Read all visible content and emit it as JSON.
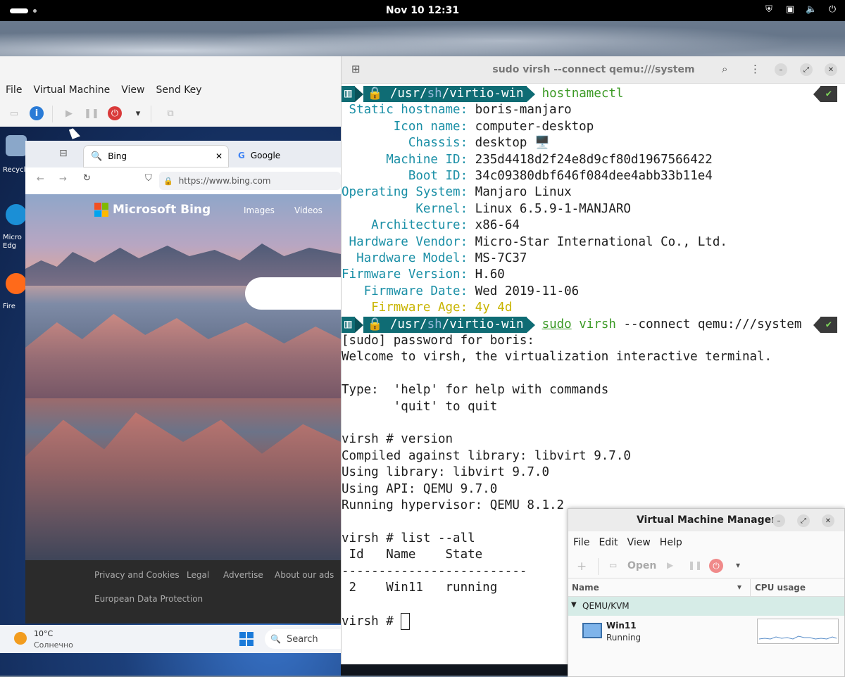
{
  "topbar": {
    "clock": "Nov 10  12:31",
    "icons": [
      "shield-icon",
      "display-icon",
      "volume-icon",
      "power-icon"
    ]
  },
  "vm_viewer": {
    "menu": [
      "File",
      "Virtual Machine",
      "View",
      "Send Key"
    ],
    "guest": {
      "desktop_icons": [
        "Recycl",
        "Micro Edg",
        "Fire"
      ],
      "browser": {
        "tabs": [
          "Bing",
          "Google"
        ],
        "url": "https://www.bing.com",
        "bing_logo": "Microsoft Bing",
        "nav": [
          "Images",
          "Videos"
        ],
        "footer": [
          "Privacy and Cookies",
          "Legal",
          "Advertise",
          "About our ads",
          "European Data Protection"
        ]
      },
      "taskbar": {
        "temp": "10°C",
        "weather": "Солнечно",
        "search": "Search"
      }
    }
  },
  "terminal": {
    "title": "sudo virsh --connect qemu:///system",
    "prompt": {
      "usr": "/usr/",
      "sh": "sh",
      "dir": "/virtio-win"
    },
    "cmd1": "hostnamectl",
    "hostinfo": [
      {
        "k": " Static hostname:",
        "v": "boris-manjaro"
      },
      {
        "k": "       Icon name:",
        "v": "computer-desktop"
      },
      {
        "k": "         Chassis:",
        "v": "desktop 🖥️"
      },
      {
        "k": "      Machine ID:",
        "v": "235d4418d2f24e8d9cf80d1967566422"
      },
      {
        "k": "         Boot ID:",
        "v": "34c09380dbf646f084dee4abb33b11e4"
      },
      {
        "k": "Operating System:",
        "v": "Manjaro Linux"
      },
      {
        "k": "          Kernel:",
        "v": "Linux 6.5.9-1-MANJARO"
      },
      {
        "k": "    Architecture:",
        "v": "x86-64"
      },
      {
        "k": " Hardware Vendor:",
        "v": "Micro-Star International Co., Ltd."
      },
      {
        "k": "  Hardware Model:",
        "v": "MS-7C37"
      },
      {
        "k": "Firmware Version:",
        "v": "H.60"
      },
      {
        "k": "   Firmware Date:",
        "v": "Wed 2019-11-06"
      },
      {
        "k": "    Firmware Age:",
        "v": "4y 4d"
      }
    ],
    "cmd2_sudo": "sudo",
    "cmd2_virsh": "virsh",
    "cmd2_rest": " --connect qemu:///system",
    "output": [
      "[sudo] password for boris:",
      "Welcome to virsh, the virtualization interactive terminal.",
      "",
      "Type:  'help' for help with commands",
      "       'quit' to quit",
      "",
      "virsh # version",
      "Compiled against library: libvirt 9.7.0",
      "Using library: libvirt 9.7.0",
      "Using API: QEMU 9.7.0",
      "Running hypervisor: QEMU 8.1.2",
      "",
      "virsh # list --all",
      " Id   Name    State",
      "-------------------------",
      " 2    Win11   running",
      ""
    ],
    "final_prompt": "virsh # "
  },
  "vmm": {
    "title": "Virtual Machine Manager",
    "menu": [
      "File",
      "Edit",
      "View",
      "Help"
    ],
    "open_label": "Open",
    "col_name": "Name",
    "col_cpu": "CPU usage",
    "group": "QEMU/KVM",
    "vm_name": "Win11",
    "vm_state": "Running"
  }
}
